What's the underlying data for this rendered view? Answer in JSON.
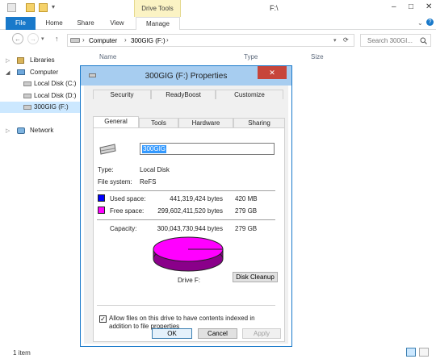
{
  "window": {
    "title": "F:\\",
    "context_tab_group": "Drive Tools",
    "caption_minimize": "–",
    "caption_maximize": "□",
    "caption_close": "✕"
  },
  "ribbon": {
    "tabs": [
      "File",
      "Home",
      "Share",
      "View",
      "Manage"
    ]
  },
  "address": {
    "breadcrumb": [
      "Computer",
      "300GIG (F:)"
    ],
    "search_placeholder": "Search 300GI..."
  },
  "nav": {
    "items": [
      {
        "label": "Libraries",
        "icon": "libraries-icon"
      },
      {
        "label": "Computer",
        "icon": "computer-icon"
      },
      {
        "label": "Local Disk (C:)",
        "icon": "drive-icon"
      },
      {
        "label": "Local Disk (D:)",
        "icon": "drive-icon"
      },
      {
        "label": "300GIG (F:)",
        "icon": "drive-icon",
        "selected": true
      },
      {
        "label": "Network",
        "icon": "network-icon"
      }
    ]
  },
  "columns": [
    "Name",
    "Type",
    "Size"
  ],
  "status": {
    "item_count": "1 item"
  },
  "dialog": {
    "title": "300GIG (F:) Properties",
    "close": "✕",
    "tabs_row1": [
      "Security",
      "ReadyBoost",
      "Customize"
    ],
    "tabs_row2": [
      "General",
      "Tools",
      "Hardware",
      "Sharing"
    ],
    "active_tab": "General",
    "drive_name": "300GIG",
    "type_label": "Type:",
    "type_value": "Local Disk",
    "fs_label": "File system:",
    "fs_value": "ReFS",
    "used_label": "Used space:",
    "used_bytes": "441,319,424 bytes",
    "used_size": "420 MB",
    "free_label": "Free space:",
    "free_bytes": "299,602,411,520 bytes",
    "free_size": "279 GB",
    "capacity_label": "Capacity:",
    "capacity_bytes": "300,043,730,944 bytes",
    "capacity_size": "279 GB",
    "drive_caption": "Drive F:",
    "disk_cleanup": "Disk Cleanup",
    "index_checkbox_label": "Allow files on this drive to have contents indexed in addition to file properties",
    "index_checked": true,
    "ok": "OK",
    "cancel": "Cancel",
    "apply": "Apply",
    "used_color": "#0000ff",
    "free_color": "#ff00ff"
  }
}
